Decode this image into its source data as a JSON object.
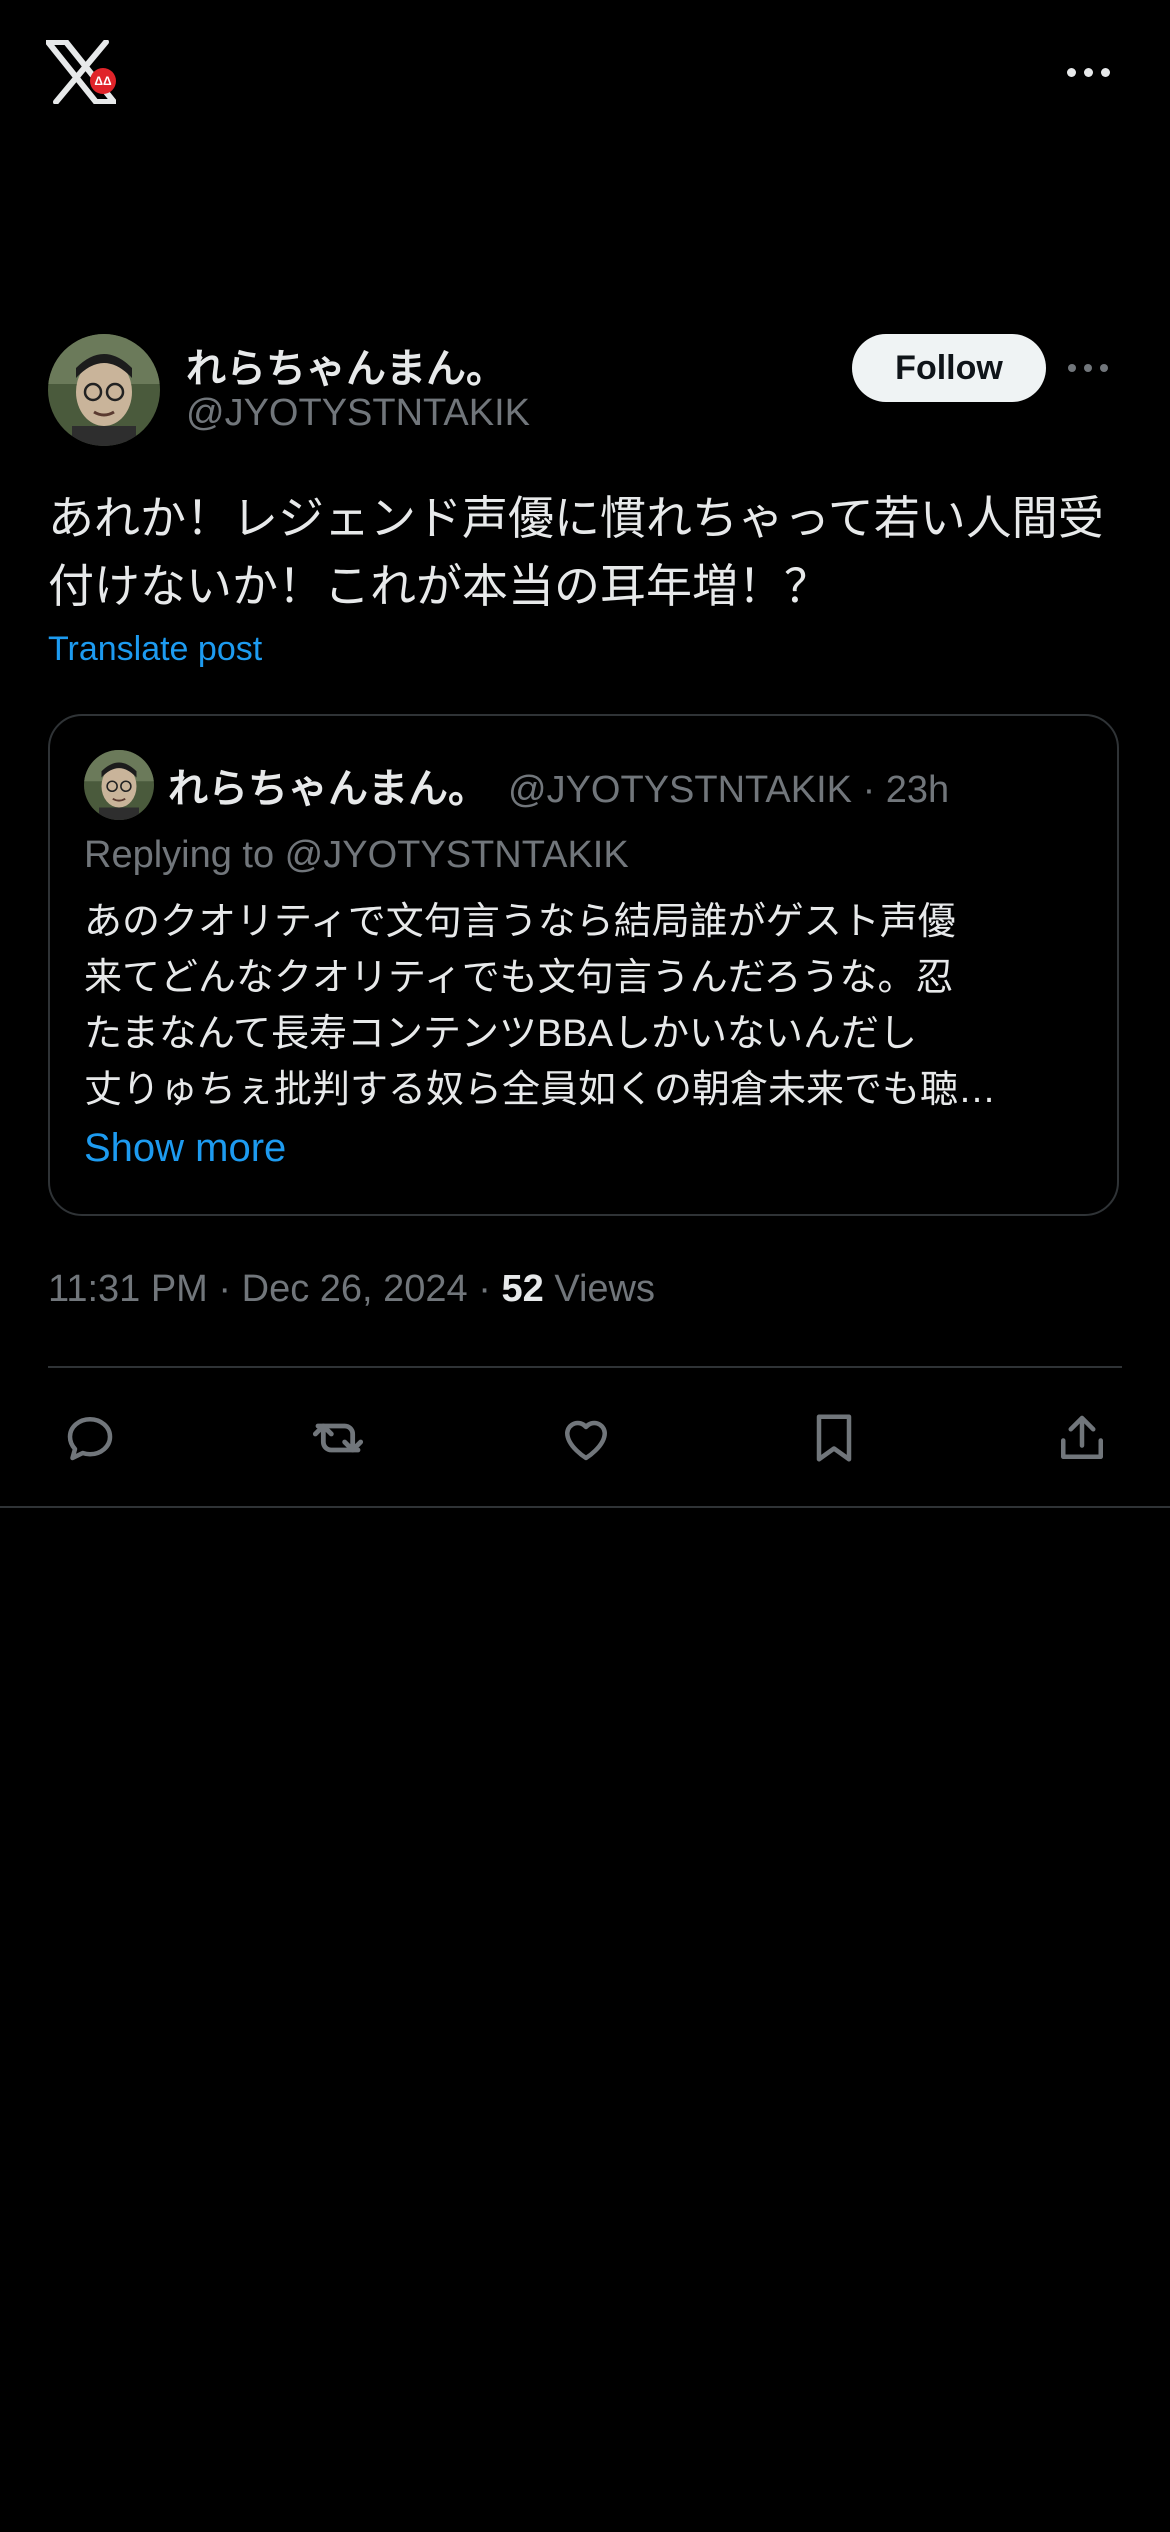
{
  "header": {
    "logo_badge": "ΔΔ"
  },
  "post": {
    "display_name": "れらちゃんまん。",
    "handle": "@JYOTYSTNTAKIK",
    "follow_label": "Follow",
    "text": "あれか！レジェンド声優に慣れちゃって若い人間受付けないか！これが本当の耳年増！？",
    "translate_label": "Translate post",
    "time": "11:31 PM",
    "date": "Dec 26, 2024",
    "views_count": "52",
    "views_label": "Views"
  },
  "quote": {
    "display_name": "れらちゃんまん。",
    "handle_time": "@JYOTYSTNTAKIK · 23h",
    "replying_to": "Replying to @JYOTYSTNTAKIK",
    "lines": [
      "あのクオリティで文句言うなら結局誰がゲスト声優",
      "来てどんなクオリティでも文句言うんだろうな。忍",
      "たまなんて長寿コンテンツBBAしかいないんだし",
      "丈りゅちぇ批判する奴ら全員如くの朝倉未来でも聴…"
    ],
    "show_more": "Show more"
  },
  "icons": {
    "logo": "x-logo-icon",
    "more": "more-dots-icon",
    "reply": "reply-icon",
    "repost": "repost-icon",
    "like": "like-icon",
    "bookmark": "bookmark-icon",
    "share": "share-icon"
  },
  "colors": {
    "background": "#000000",
    "accent": "#1d9bf0",
    "muted": "#71767b",
    "divider": "#2f3336"
  }
}
